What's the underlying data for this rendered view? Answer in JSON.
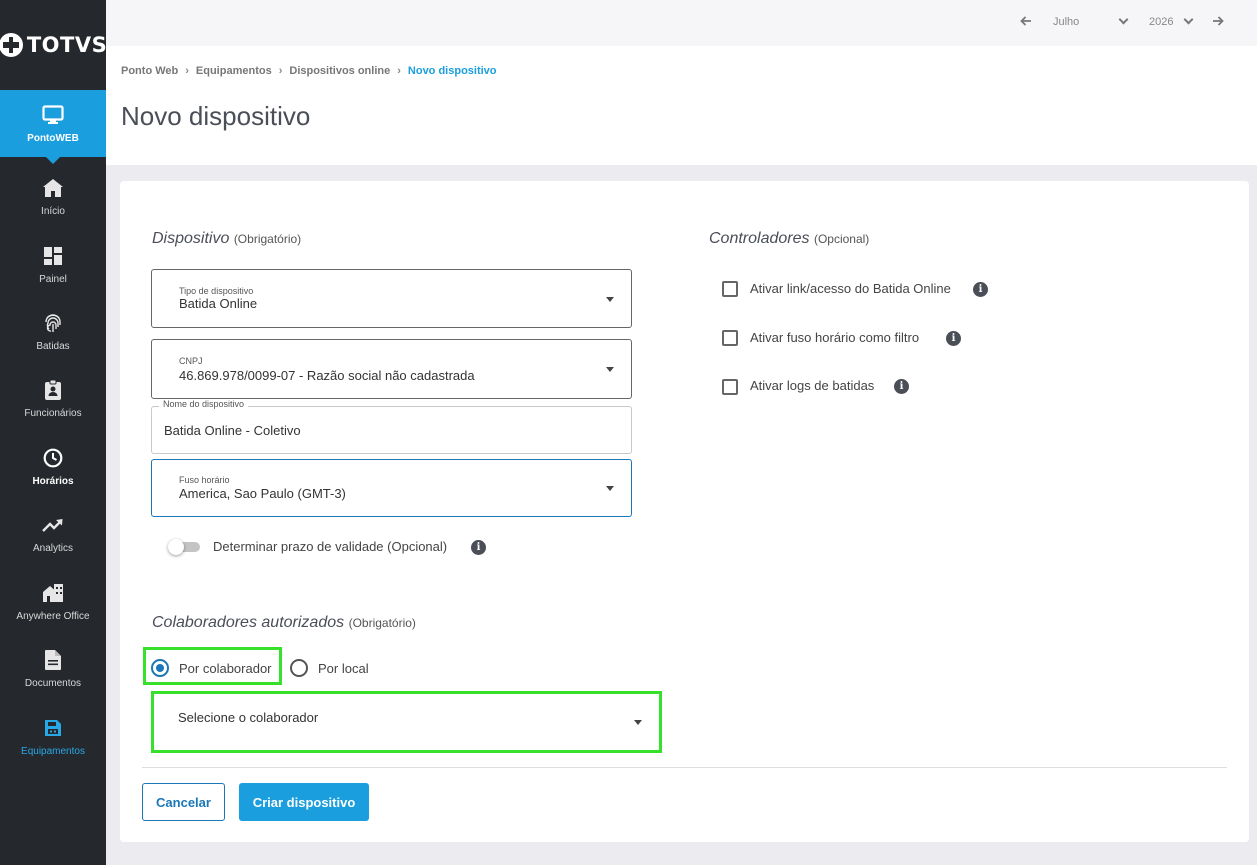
{
  "brand": {
    "logo_text": "TOTVS",
    "accent": "#1a9ede",
    "sidebar_bg": "#25282d",
    "highlight": "#37e02b"
  },
  "sidebar": {
    "items": [
      {
        "label": "PontoWEB",
        "icon": "monitor-icon"
      },
      {
        "label": "Início",
        "icon": "home-icon"
      },
      {
        "label": "Painel",
        "icon": "dashboard-icon"
      },
      {
        "label": "Batidas",
        "icon": "fingerprint-icon"
      },
      {
        "label": "Funcionários",
        "icon": "badge-icon"
      },
      {
        "label": "Horários",
        "icon": "clock-icon"
      },
      {
        "label": "Analytics",
        "icon": "trending-up-icon"
      },
      {
        "label": "Anywhere Office",
        "icon": "office-building-icon"
      },
      {
        "label": "Documentos",
        "icon": "document-icon"
      },
      {
        "label": "Equipamentos",
        "icon": "device-icon"
      }
    ]
  },
  "topbar": {
    "month": "Julho",
    "year": "2026"
  },
  "breadcrumb": [
    "Ponto Web",
    "Equipamentos",
    "Dispositivos online",
    "Novo dispositivo"
  ],
  "page_title": "Novo dispositivo",
  "dispositivo": {
    "title": "Dispositivo",
    "note": "(Obrigatório)",
    "tipo": {
      "label": "Tipo de dispositivo",
      "value": "Batida Online"
    },
    "cnpj": {
      "label": "CNPJ",
      "value": "46.869.978/0099-07 - Razão social não cadastrada"
    },
    "nome": {
      "label": "Nome do dispositivo",
      "value": "Batida Online - Coletivo"
    },
    "fuso": {
      "label": "Fuso horário",
      "value": "America, Sao Paulo (GMT-3)"
    },
    "validade_label": "Determinar prazo de validade (Opcional)"
  },
  "controladores": {
    "title": "Controladores",
    "note": "(Opcional)",
    "options": [
      "Ativar link/acesso do Batida Online",
      "Ativar fuso horário como filtro",
      "Ativar logs de batidas"
    ]
  },
  "colaboradores": {
    "title": "Colaboradores autorizados",
    "note": "(Obrigatório)",
    "radio_colaborador": "Por colaborador",
    "radio_local": "Por local",
    "select_placeholder": "Selecione o colaborador"
  },
  "actions": {
    "cancel": "Cancelar",
    "create": "Criar dispositivo"
  }
}
